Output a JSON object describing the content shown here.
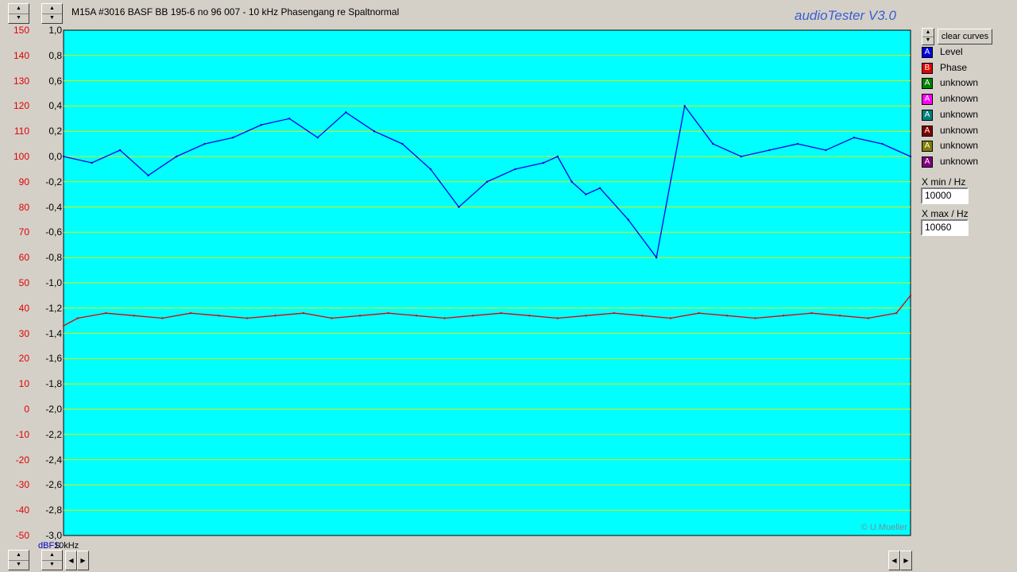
{
  "title": "M15A #3016 BASF BB 195-6 no 96 007 - 10 kHz Phasengang re Spaltnormal",
  "brand": "audioTester  V3.0",
  "copyright": "© U.Mueller",
  "controls": {
    "clear_curves": "clear curves",
    "xmin_label": "X min / Hz",
    "xmin_value": "10000",
    "xmax_label": "X max / Hz",
    "xmax_value": "10060"
  },
  "legend": [
    {
      "letter": "A",
      "label": "Level",
      "color": "#0000e0"
    },
    {
      "letter": "B",
      "label": "Phase",
      "color": "#e00000"
    },
    {
      "letter": "A",
      "label": "unknown",
      "color": "#008000"
    },
    {
      "letter": "A",
      "label": "unknown",
      "color": "#ff00ff"
    },
    {
      "letter": "A",
      "label": "unknown",
      "color": "#008080"
    },
    {
      "letter": "A",
      "label": "unknown",
      "color": "#800000"
    },
    {
      "letter": "A",
      "label": "unknown",
      "color": "#808000"
    },
    {
      "letter": "A",
      "label": "unknown",
      "color": "#800080"
    }
  ],
  "chart_data": {
    "type": "line",
    "title": "M15A #3016 BASF BB 195-6 no 96 007 - 10 kHz Phasengang re Spaltnormal",
    "x_unit_label": "10kHz",
    "y_unit_label": "dBFS",
    "xlim": [
      10000,
      10060
    ],
    "ylim_right": [
      -3.0,
      1.0
    ],
    "ylim_left": [
      -50,
      150
    ],
    "y_ticks_right": [
      "1,0",
      "0,8",
      "0,6",
      "0,4",
      "0,2",
      "0,0",
      "-0,2",
      "-0,4",
      "-0,6",
      "-0,8",
      "-1,0",
      "-1,2",
      "-1,4",
      "-1,6",
      "-1,8",
      "-2,0",
      "-2,2",
      "-2,4",
      "-2,6",
      "-2,8",
      "-3,0"
    ],
    "y_ticks_left": [
      "150",
      "140",
      "130",
      "120",
      "110",
      "100",
      "90",
      "80",
      "70",
      "60",
      "50",
      "40",
      "30",
      "20",
      "10",
      "0",
      "-10",
      "-20",
      "-30",
      "-40",
      "-50"
    ],
    "grid": true,
    "background": "#00ffff",
    "gridline_color": "#e8e800",
    "series": [
      {
        "name": "Level",
        "color": "#0000e0",
        "x": [
          10000,
          10002,
          10004,
          10006,
          10008,
          10010,
          10012,
          10014,
          10016,
          10018,
          10020,
          10022,
          10024,
          10026,
          10028,
          10030,
          10032,
          10034,
          10035,
          10036,
          10037,
          10038,
          10040,
          10042,
          10044,
          10046,
          10048,
          10050,
          10052,
          10054,
          10056,
          10058,
          10060
        ],
        "y": [
          0.0,
          -0.05,
          0.05,
          -0.15,
          0.0,
          0.1,
          0.15,
          0.25,
          0.3,
          0.15,
          0.35,
          0.2,
          0.1,
          -0.1,
          -0.4,
          -0.2,
          -0.1,
          -0.05,
          0.0,
          -0.2,
          -0.3,
          -0.25,
          -0.5,
          -0.8,
          0.4,
          0.1,
          0.0,
          0.05,
          0.1,
          0.05,
          0.15,
          0.1,
          0.0
        ]
      },
      {
        "name": "Phase",
        "color": "#e00000",
        "x": [
          10000,
          10001,
          10003,
          10005,
          10007,
          10009,
          10011,
          10013,
          10015,
          10017,
          10019,
          10021,
          10023,
          10025,
          10027,
          10029,
          10031,
          10033,
          10035,
          10037,
          10039,
          10041,
          10043,
          10045,
          10047,
          10049,
          10051,
          10053,
          10055,
          10057,
          10059,
          10060
        ],
        "y": [
          33,
          36,
          38,
          37,
          36,
          38,
          37,
          36,
          37,
          38,
          36,
          37,
          38,
          37,
          36,
          37,
          38,
          37,
          36,
          37,
          38,
          37,
          36,
          38,
          37,
          36,
          37,
          38,
          37,
          36,
          38,
          45
        ]
      }
    ]
  }
}
